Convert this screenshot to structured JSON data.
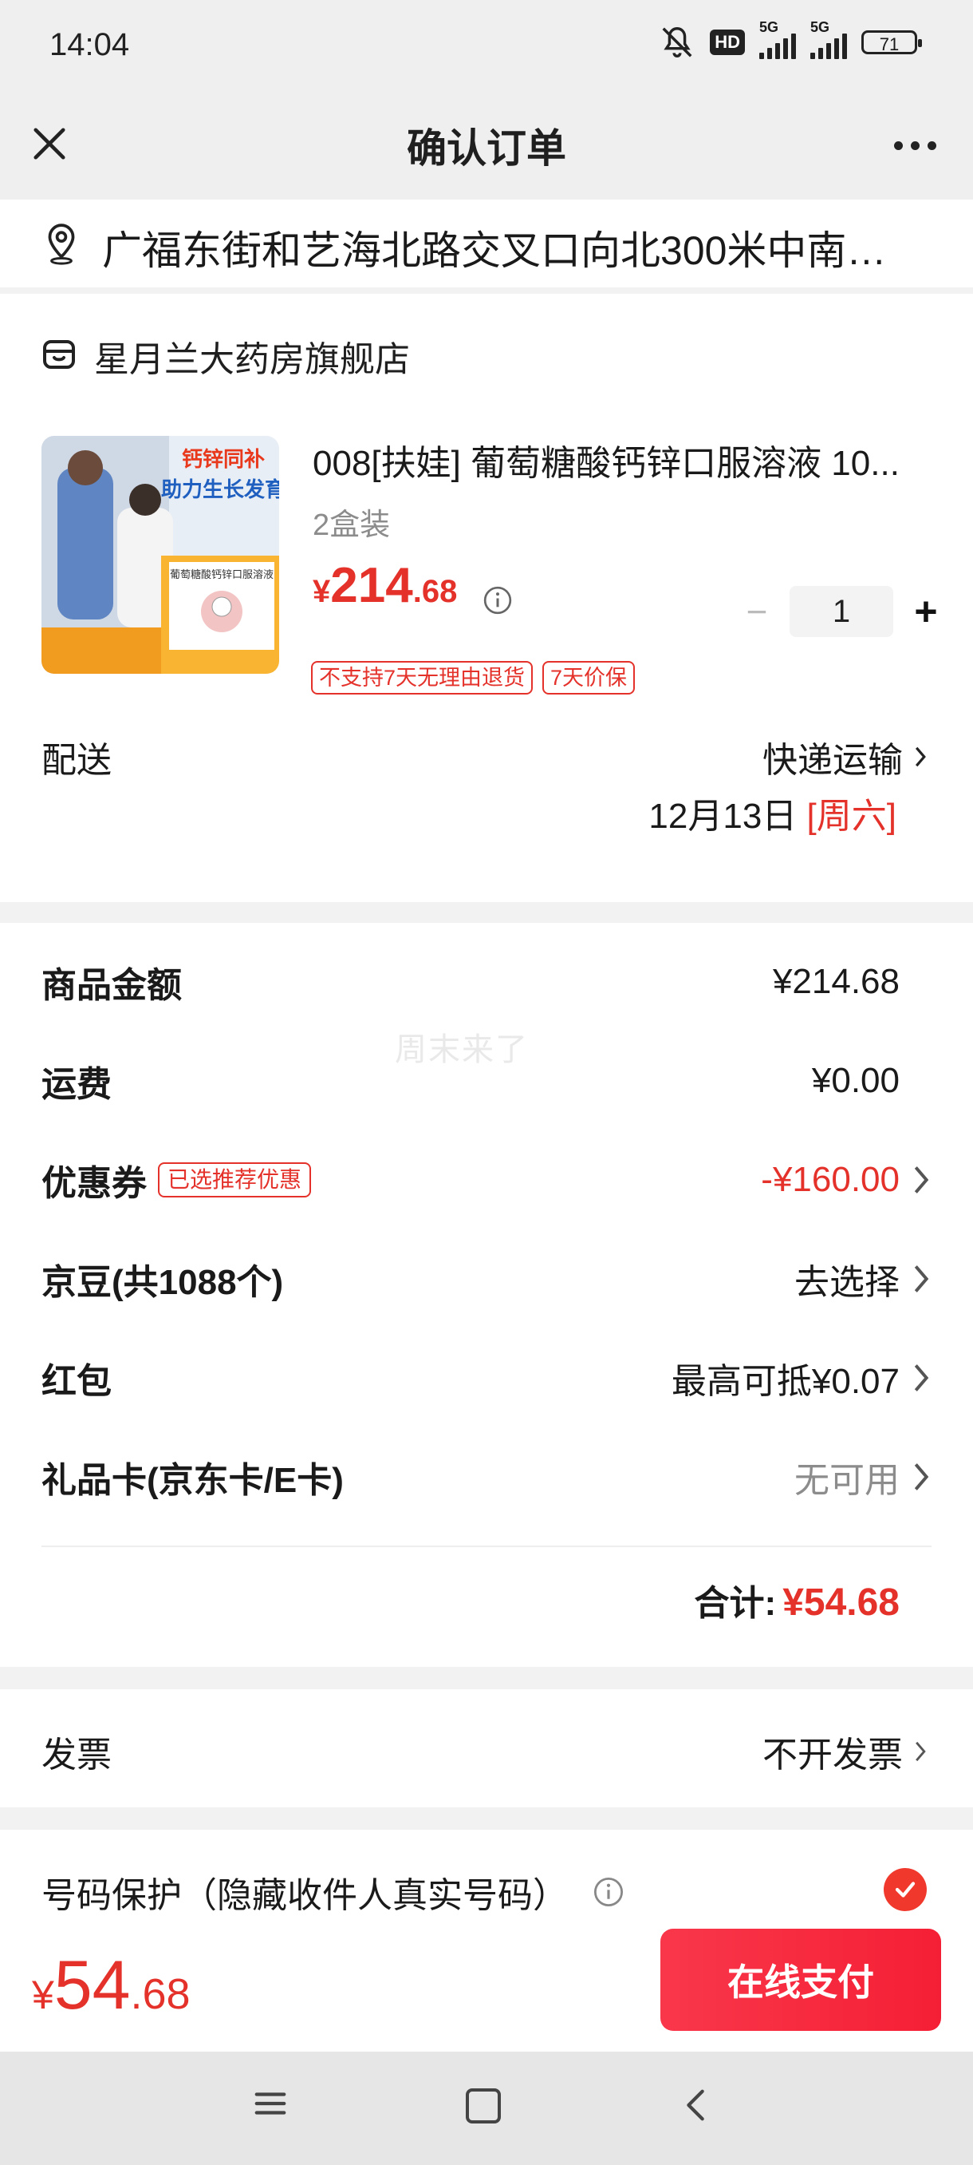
{
  "status_bar": {
    "time": "14:04",
    "hd_label": "HD",
    "signal1_label": "5G",
    "signal2_label": "5G",
    "battery": "71"
  },
  "nav": {
    "title": "确认订单"
  },
  "address": {
    "text": "广福东街和艺海北路交叉口向北300米中南…"
  },
  "store": {
    "name": "星月兰大药房旗舰店",
    "product": {
      "title": "008[扶娃] 葡萄糖酸钙锌口服溶液 10...",
      "spec": "2盒装",
      "price_currency": "¥",
      "price_int": "214",
      "price_dec": ".68",
      "quantity": "1",
      "tags": [
        "不支持7天无理由退货",
        "7天价保"
      ],
      "image_caption_top": "钙锌同补",
      "image_caption_mid": "助力生长发育",
      "image_box_label": "葡萄糖酸钙锌口服溶液"
    },
    "delivery": {
      "label": "配送",
      "method": "快递运输",
      "date": "12月13日",
      "weekday": "[周六]"
    }
  },
  "price_detail": {
    "rows": [
      {
        "label": "商品金额",
        "value": "¥214.68"
      },
      {
        "label": "运费",
        "value": "¥0.00"
      },
      {
        "label": "优惠券",
        "badge": "已选推荐优惠",
        "value": "-¥160.00"
      },
      {
        "label": "京豆(共1088个)",
        "value": "去选择"
      },
      {
        "label": "红包",
        "value": "最高可抵¥0.07"
      },
      {
        "label": "礼品卡(京东卡/E卡)",
        "value": "无可用"
      }
    ],
    "total_label": "合计:",
    "total_value": "¥54.68",
    "watermark": "周末来了"
  },
  "invoice": {
    "label": "发票",
    "value": "不开发票"
  },
  "phone_protect": {
    "label": "号码保护（隐藏收件人真实号码）"
  },
  "pay_bar": {
    "currency": "¥",
    "amount_int": "54",
    "amount_dec": ".68",
    "button": "在线支付"
  },
  "colors": {
    "accent_red": "#e4322b",
    "pay_button": "#f72a40"
  }
}
